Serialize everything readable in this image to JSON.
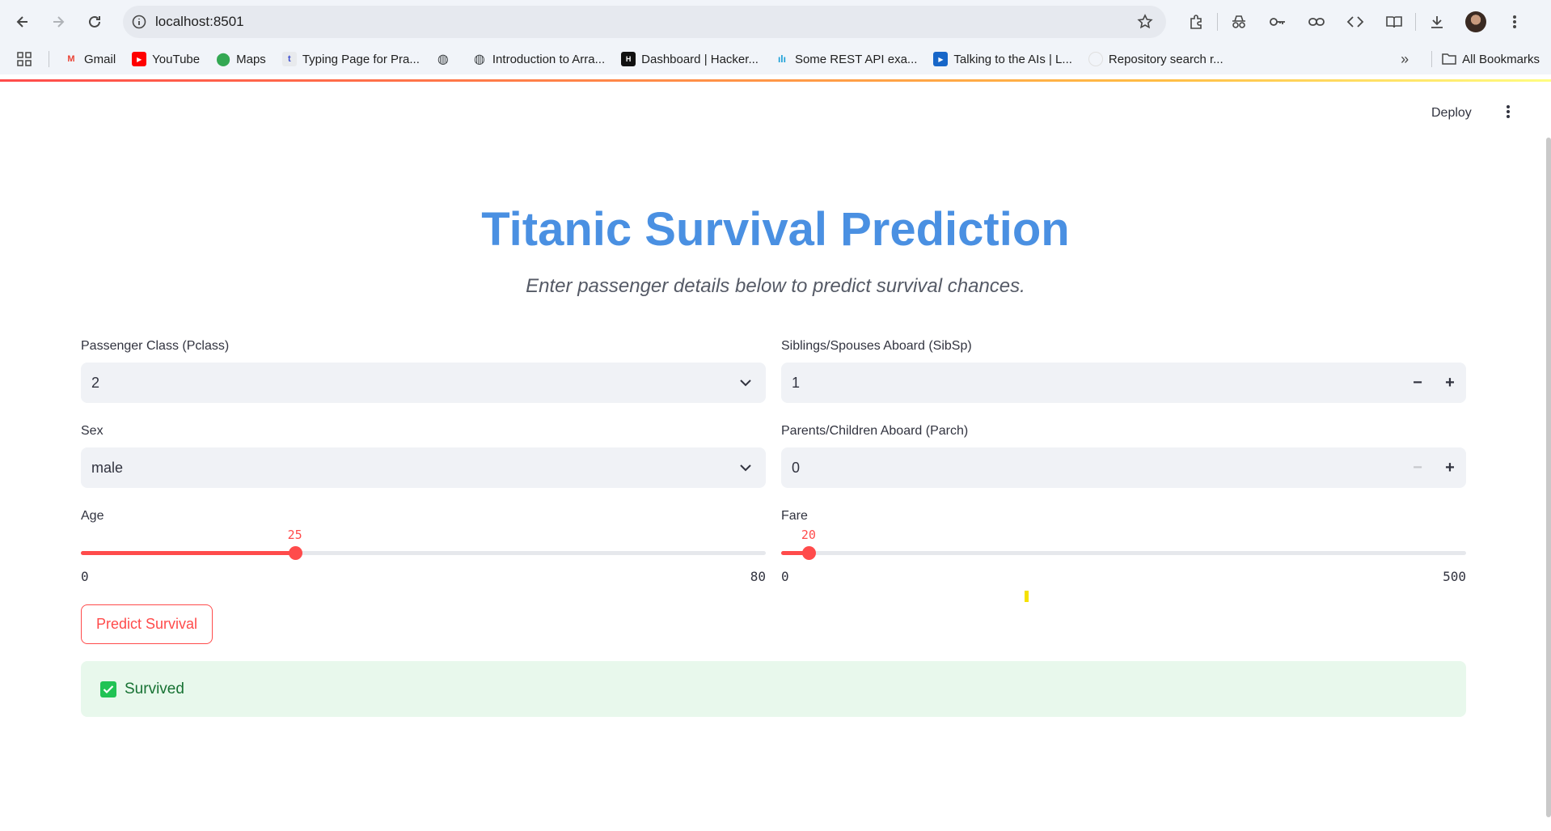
{
  "browser": {
    "url": "localhost:8501",
    "bookmarks": [
      {
        "label": "Gmail",
        "icon": "gmail-icon"
      },
      {
        "label": "YouTube",
        "icon": "youtube-icon"
      },
      {
        "label": "Maps",
        "icon": "maps-icon"
      },
      {
        "label": "Typing Page for Pra...",
        "icon": "typing-icon"
      },
      {
        "label": "",
        "icon": "globe-icon"
      },
      {
        "label": "Introduction to Arra...",
        "icon": "globe-icon"
      },
      {
        "label": "Dashboard | Hacker...",
        "icon": "hackerrank-icon"
      },
      {
        "label": "Some REST API exa...",
        "icon": "cisco-icon"
      },
      {
        "label": "Talking to the AIs | L...",
        "icon": "video-icon"
      },
      {
        "label": "Repository search r...",
        "icon": "github-icon"
      }
    ],
    "all_bookmarks": "All Bookmarks"
  },
  "app": {
    "deploy": "Deploy",
    "title": "Titanic Survival Prediction",
    "subtitle": "Enter passenger details below to predict survival chances.",
    "pclass": {
      "label": "Passenger Class (Pclass)",
      "value": "2"
    },
    "sex": {
      "label": "Sex",
      "value": "male"
    },
    "sibsp": {
      "label": "Siblings/Spouses Aboard (SibSp)",
      "value": "1",
      "minus": "−",
      "plus": "+"
    },
    "parch": {
      "label": "Parents/Children Aboard (Parch)",
      "value": "0",
      "minus": "−",
      "plus": "+"
    },
    "age": {
      "label": "Age",
      "value": 25,
      "min": 0,
      "max": 80
    },
    "fare": {
      "label": "Fare",
      "value": 20,
      "min": 0,
      "max": 500
    },
    "predict_button": "Predict Survival",
    "result": "Survived"
  },
  "colors": {
    "accent": "#ff4b4b",
    "title": "#4a90e2",
    "success_bg": "#e8f8ec",
    "success_text": "#177233"
  }
}
